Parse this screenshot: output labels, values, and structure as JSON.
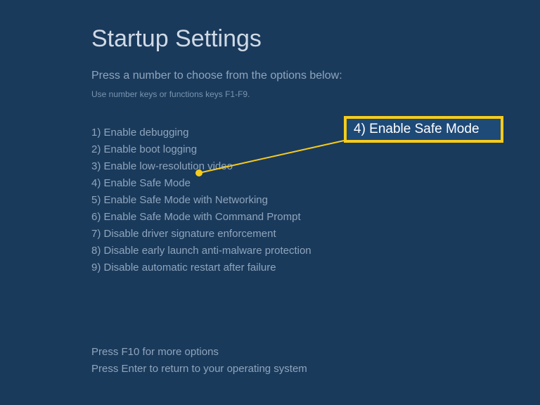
{
  "title": "Startup Settings",
  "subtitle": "Press a number to choose from the options below:",
  "hint": "Use number keys or functions keys F1-F9.",
  "options": [
    "1) Enable debugging",
    "2) Enable boot logging",
    "3) Enable low-resolution video",
    "4) Enable Safe Mode",
    "5) Enable Safe Mode with Networking",
    "6) Enable Safe Mode with Command Prompt",
    "7) Disable driver signature enforcement",
    "8) Disable early launch anti-malware protection",
    "9) Disable automatic restart after failure"
  ],
  "footer": {
    "line1": "Press F10 for more options",
    "line2": "Press Enter to return to your operating system"
  },
  "callout": {
    "text": "4) Enable Safe Mode"
  }
}
